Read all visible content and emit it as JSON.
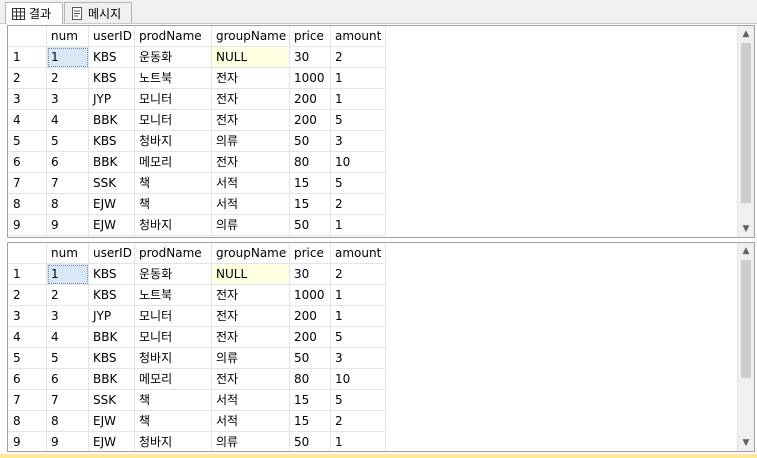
{
  "tabs": [
    {
      "label": "결과",
      "icon": "grid-icon"
    },
    {
      "label": "메시지",
      "icon": "message-icon"
    }
  ],
  "columns": [
    "num",
    "userID",
    "prodName",
    "groupName",
    "price",
    "amount"
  ],
  "rows": [
    [
      "1",
      "1",
      "KBS",
      "운동화",
      "NULL",
      "30",
      "2"
    ],
    [
      "2",
      "2",
      "KBS",
      "노트북",
      "전자",
      "1000",
      "1"
    ],
    [
      "3",
      "3",
      "JYP",
      "모니터",
      "전자",
      "200",
      "1"
    ],
    [
      "4",
      "4",
      "BBK",
      "모니터",
      "전자",
      "200",
      "5"
    ],
    [
      "5",
      "5",
      "KBS",
      "청바지",
      "의류",
      "50",
      "3"
    ],
    [
      "6",
      "6",
      "BBK",
      "메모리",
      "전자",
      "80",
      "10"
    ],
    [
      "7",
      "7",
      "SSK",
      "책",
      "서적",
      "15",
      "5"
    ],
    [
      "8",
      "8",
      "EJW",
      "책",
      "서적",
      "15",
      "2"
    ],
    [
      "9",
      "9",
      "EJW",
      "청바지",
      "의류",
      "50",
      "1"
    ]
  ],
  "scroll": {
    "up": "▲",
    "down": "▼"
  }
}
